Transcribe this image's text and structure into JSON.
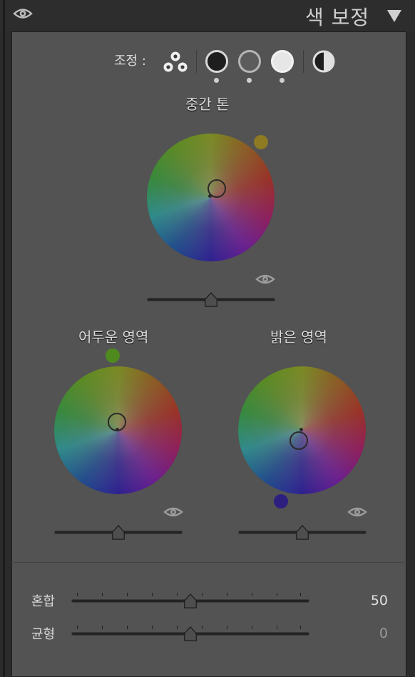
{
  "header": {
    "title": "색 보정"
  },
  "toolbar": {
    "label": "조정 :",
    "modes": [
      "three-way",
      "shadows",
      "midtones",
      "highlights",
      "global"
    ],
    "active_mode": "three-way"
  },
  "midtones": {
    "label": "중간 톤",
    "swatch_color": "#8d7a22",
    "slider_value": 0
  },
  "shadows": {
    "label": "어두운 영역",
    "swatch_color": "#4f8a1f",
    "slider_value": 0
  },
  "highlights": {
    "label": "밝은 영역",
    "swatch_color": "#2c1f80",
    "slider_value": 0
  },
  "blending": {
    "label": "혼합",
    "value": "50",
    "fraction": 0.5
  },
  "balance": {
    "label": "균형",
    "value": "0",
    "fraction": 0.5
  },
  "colors": {
    "panel_bg": "#535353",
    "header_bg": "#2d2d2d"
  }
}
